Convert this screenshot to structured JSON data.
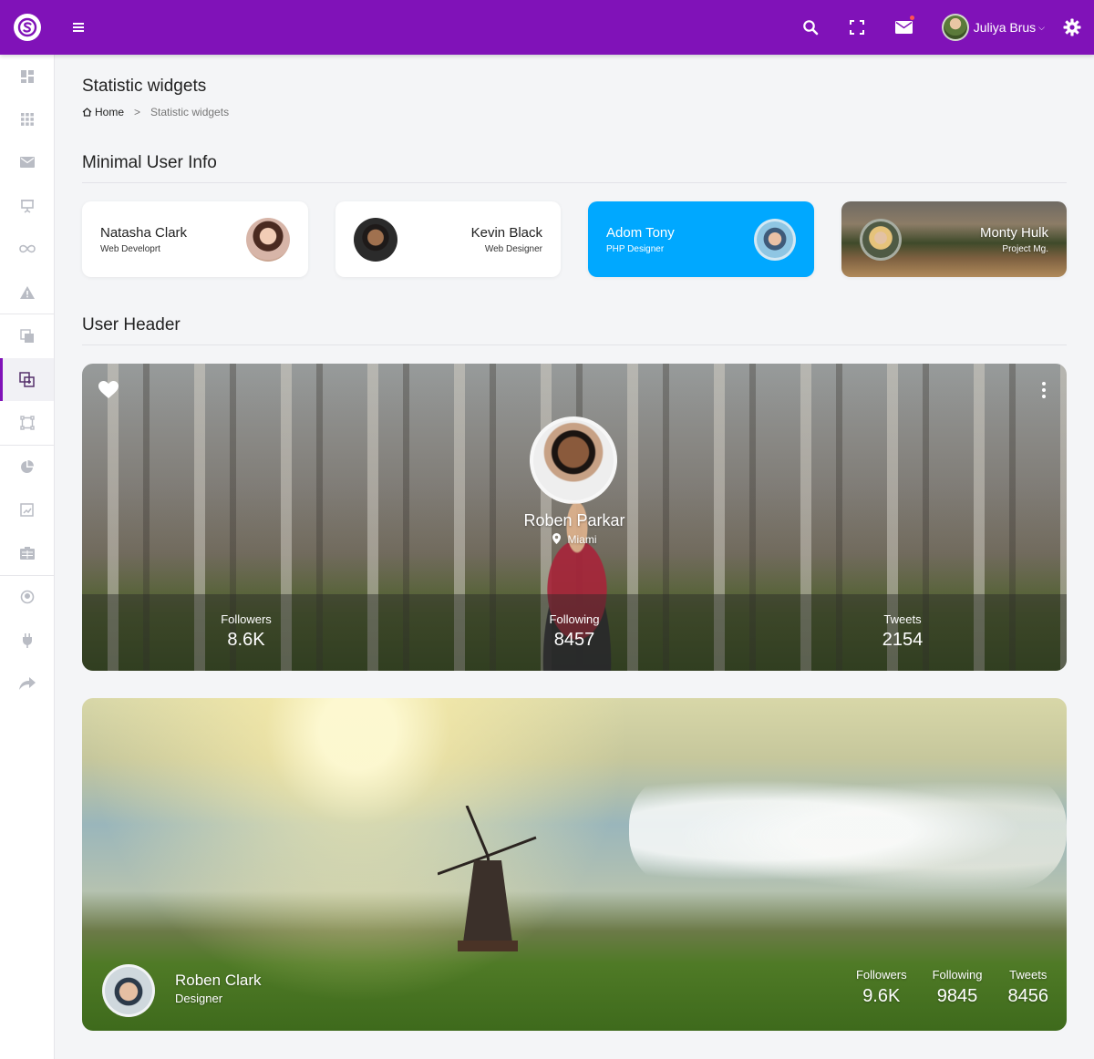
{
  "topbar": {
    "user_name": "Juliya Brus",
    "accent_color": "#8012b8",
    "icons": [
      "search-icon",
      "fullscreen-icon",
      "mail-icon",
      "gear-icon"
    ]
  },
  "sidebar": {
    "items": [
      {
        "icon": "dashboard-icon"
      },
      {
        "icon": "apps-grid-icon"
      },
      {
        "icon": "mail-icon"
      },
      {
        "icon": "presentation-icon"
      },
      {
        "icon": "infinity-icon"
      },
      {
        "icon": "warning-icon"
      },
      {
        "icon": "copy-icon"
      },
      {
        "icon": "widgets-icon",
        "active": true
      },
      {
        "icon": "vector-icon"
      },
      {
        "icon": "pie-chart-icon"
      },
      {
        "icon": "image-chart-icon"
      },
      {
        "icon": "table-icon"
      },
      {
        "icon": "map-pin-icon"
      },
      {
        "icon": "plug-icon"
      },
      {
        "icon": "share-icon"
      }
    ]
  },
  "page": {
    "title": "Statistic widgets",
    "breadcrumb": {
      "home": "Home",
      "separator": ">",
      "current": "Statistic widgets"
    }
  },
  "minimal_user_info": {
    "heading": "Minimal User Info",
    "cards": [
      {
        "name": "Natasha Clark",
        "role": "Web Developrt"
      },
      {
        "name": "Kevin Black",
        "role": "Web Designer"
      },
      {
        "name": "Adom Tony",
        "role": "PHP Designer",
        "color": "#00a8ff"
      },
      {
        "name": "Monty Hulk",
        "role": "Project Mg."
      }
    ]
  },
  "user_header": {
    "heading": "User Header",
    "card1": {
      "name": "Roben Parkar",
      "location": "Miami",
      "stats": [
        {
          "label": "Followers",
          "value": "8.6K"
        },
        {
          "label": "Following",
          "value": "8457"
        },
        {
          "label": "Tweets",
          "value": "2154"
        }
      ]
    },
    "card2": {
      "name": "Roben Clark",
      "role": "Designer",
      "stats": [
        {
          "label": "Followers",
          "value": "9.6K"
        },
        {
          "label": "Following",
          "value": "9845"
        },
        {
          "label": "Tweets",
          "value": "8456"
        }
      ]
    }
  }
}
